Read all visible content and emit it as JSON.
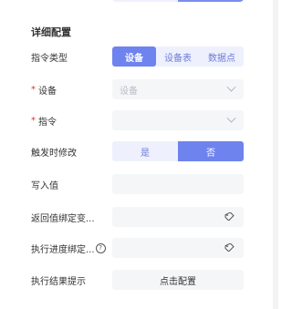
{
  "section_title": "详细配置",
  "command_type": {
    "label": "指令类型",
    "options": [
      "设备",
      "设备表",
      "数据点"
    ],
    "selected": "设备"
  },
  "device": {
    "label": "设备",
    "required": "*",
    "placeholder": "设备"
  },
  "command": {
    "label": "指令",
    "required": "*",
    "placeholder": ""
  },
  "modify_on_trigger": {
    "label": "触发时修改",
    "options": [
      "是",
      "否"
    ],
    "selected": "否"
  },
  "write_value": {
    "label": "写入值",
    "value": ""
  },
  "return_binding": {
    "label": "返回值绑定变..."
  },
  "progress_binding": {
    "label": "执行进度绑定...",
    "help": "?"
  },
  "result_prompt": {
    "label": "执行结果提示",
    "button": "点击配置"
  },
  "icons": {
    "tag": "tag-icon",
    "chevron": "chevron-down-icon",
    "help": "question-circle-icon"
  },
  "colors": {
    "accent": "#6e83ee",
    "accent_light": "#eef1fd",
    "required": "#e0303a",
    "field_bg": "#f5f6f8"
  }
}
